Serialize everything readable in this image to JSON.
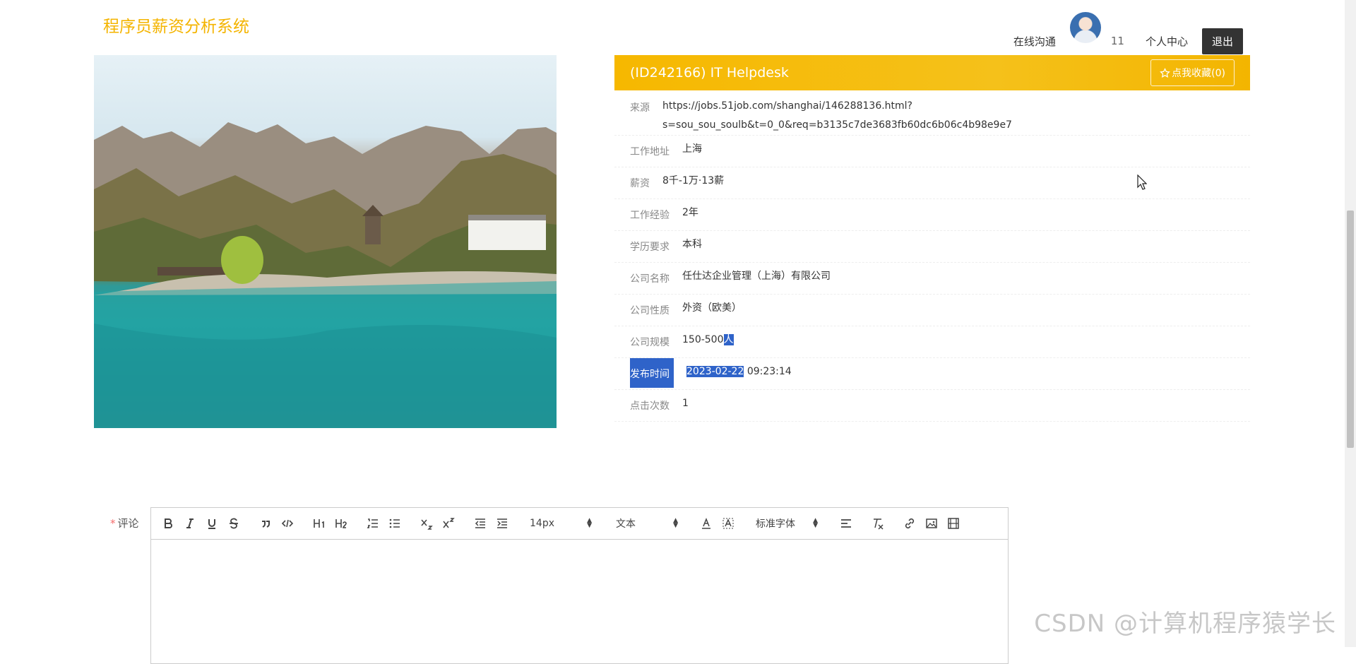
{
  "header": {
    "site_title": "程序员薪资分析系统",
    "nav_online_chat": "在线沟通",
    "user_name": "11",
    "nav_profile": "个人中心",
    "logout": "退出"
  },
  "detail": {
    "title": "(ID242166) IT Helpdesk",
    "favorite": "点我收藏(0)",
    "source_label": "来源",
    "source_line1": "https://jobs.51job.com/shanghai/146288136.html?",
    "source_line2": "s=sou_sou_soulb&t=0_0&req=b3135c7de3683fb60dc6b06c4b98e9e7",
    "rows": [
      {
        "label": "工作地址",
        "value": "上海"
      },
      {
        "label": "薪资",
        "value": "8千-1万·13薪"
      },
      {
        "label": "工作经验",
        "value": "2年"
      },
      {
        "label": "学历要求",
        "value": "本科"
      },
      {
        "label": "公司名称",
        "value": "任仕达企业管理（上海）有限公司"
      },
      {
        "label": "公司性质",
        "value": "外资（欧美）"
      }
    ],
    "scale_label": "公司规模",
    "scale_value_a": "150-500",
    "scale_value_b": "人",
    "publish_label": "发布时间",
    "publish_date": "2023-02-22",
    "publish_time": " 09:23:14",
    "clicks_label": "点击次数",
    "clicks_value": "1"
  },
  "comment": {
    "required_mark": "*",
    "label": "评论",
    "font_size": "14px",
    "block_type": "文本",
    "font_family": "标准字体"
  },
  "toolbar_icons": [
    "bold-icon",
    "italic-icon",
    "underline-icon",
    "strike-icon",
    "quote-icon",
    "code-icon",
    "h1-icon",
    "h2-icon",
    "ordered-list-icon",
    "bullet-list-icon",
    "subscript-icon",
    "superscript-icon",
    "outdent-icon",
    "indent-icon",
    "font-color-icon",
    "background-color-icon",
    "align-icon",
    "clear-format-icon",
    "link-icon",
    "image-icon",
    "video-icon"
  ],
  "watermark": "CSDN @计算机程序猿学长",
  "colors": {
    "accent": "#f6b800",
    "selection": "#2f63c9",
    "logout_bg": "#333333"
  }
}
